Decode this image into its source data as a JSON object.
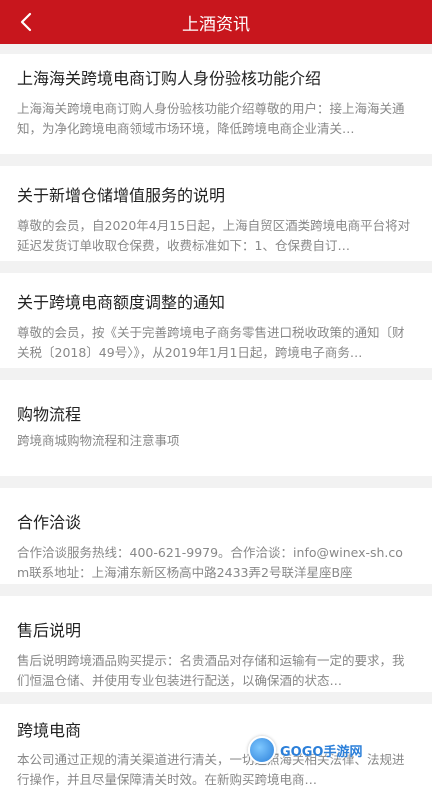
{
  "header": {
    "title": "上酒资讯",
    "back_icon": "chevron-left-icon"
  },
  "articles": [
    {
      "title": "上海海关跨境电商订购人身份验核功能介绍",
      "desc": "上海海关跨境电商订购人身份验核功能介绍尊敬的用户：接上海海关通知，为净化跨境电商领域市场环境，降低跨境电商企业清关…"
    },
    {
      "title": "关于新增仓储增值服务的说明",
      "desc": "尊敬的会员，自2020年4月15日起，上海自贸区酒类跨境电商平台将对延迟发货订单收取仓保费，收费标准如下：1、仓保费自订…"
    },
    {
      "title": "关于跨境电商额度调整的通知",
      "desc": "尊敬的会员，按《关于完善跨境电子商务零售进口税收政策的通知〔财关税〔2018〕49号〉》，从2019年1月1日起，跨境电子商务…"
    },
    {
      "title": "购物流程",
      "desc": "跨境商城购物流程和注意事项"
    },
    {
      "title": "合作洽谈",
      "desc": "合作洽谈服务热线：400-621-9979。合作洽谈：info@winex-sh.com联系地址：上海浦东新区杨高中路2433弄2号联洋星座B座"
    },
    {
      "title": "售后说明",
      "desc": "售后说明跨境酒品购买提示：名贵酒品对存储和运输有一定的要求，我们恒温仓储、并使用专业包装进行配送，以确保酒的状态…"
    },
    {
      "title": "跨境电商",
      "desc": "本公司通过正规的清关渠道进行清关，一切遵照海关相关法律、法规进行操作，并且尽量保障清关时效。在新购买跨境电商…"
    }
  ],
  "watermark": {
    "text": "GOGO手游网"
  }
}
